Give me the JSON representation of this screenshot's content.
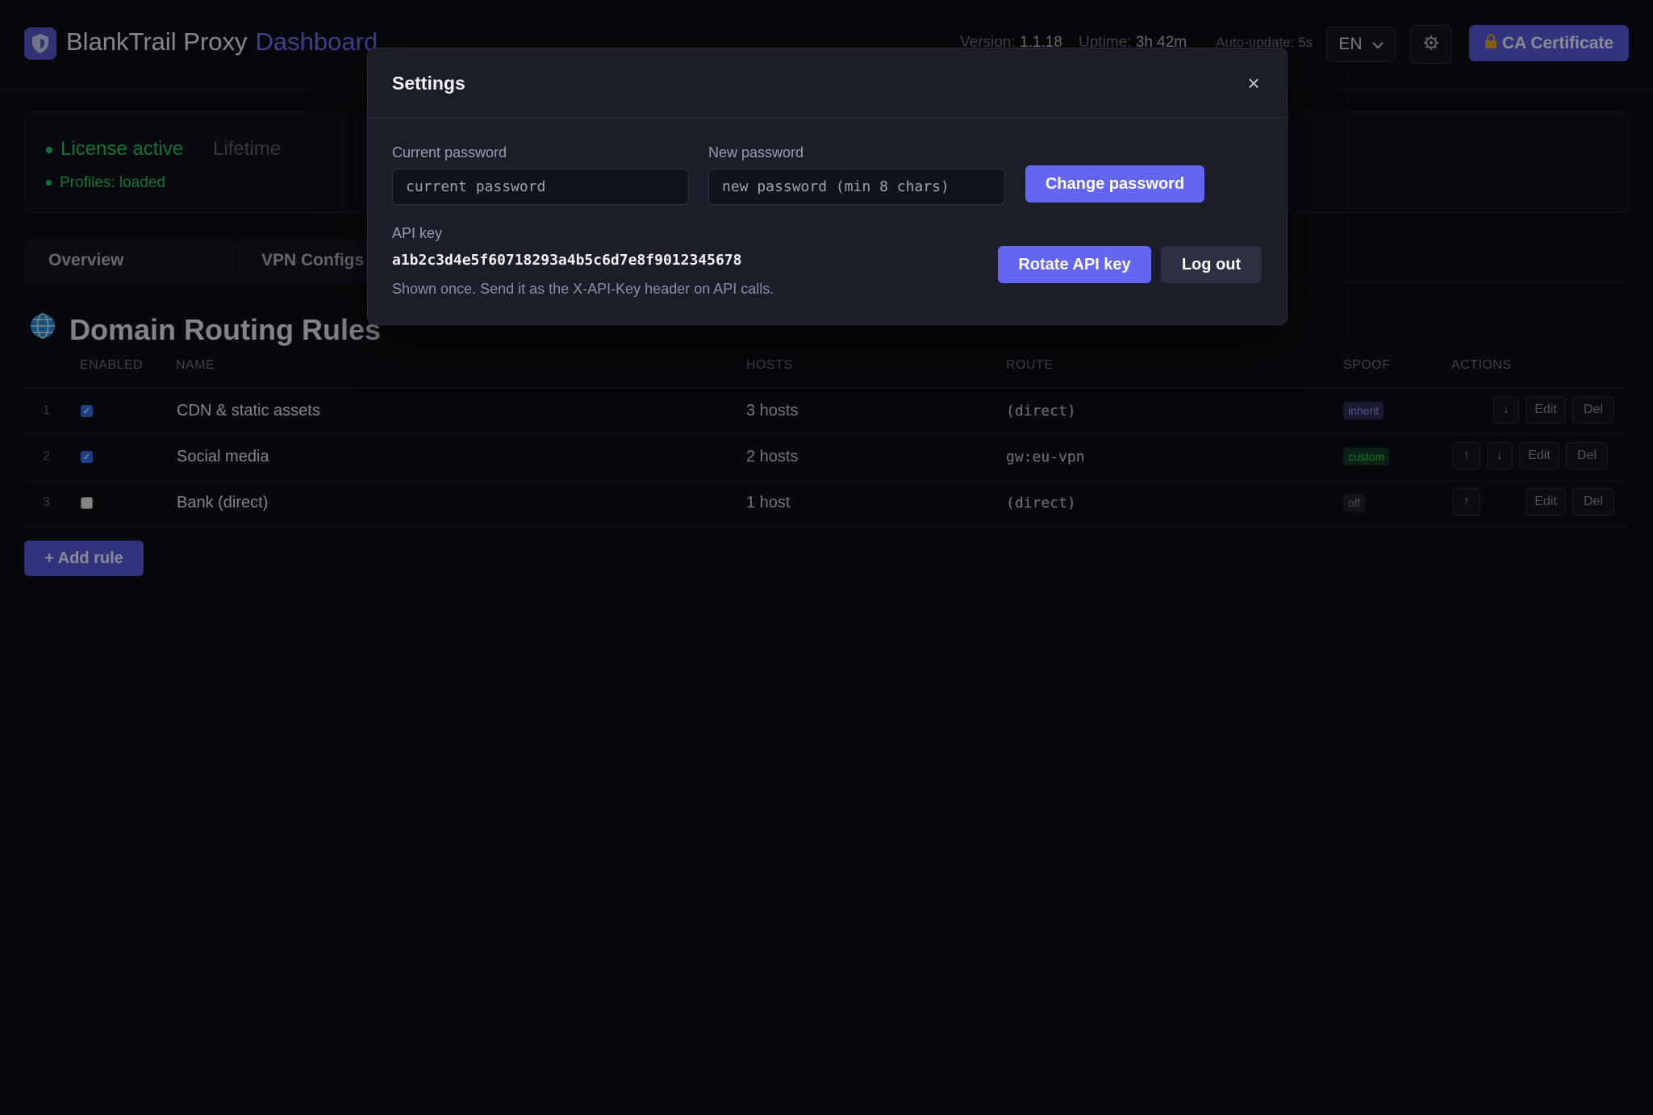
{
  "header": {
    "app_name": "BlankTrail Proxy",
    "app_section": "Dashboard",
    "version_label": "Version:",
    "version_value": "1.1.18",
    "uptime_label": "Uptime:",
    "uptime_value": "3h 42m",
    "auto_update": "Auto-update: 5s",
    "language": "EN",
    "ca_button": "CA Certificate",
    "icons": {
      "logo": "shield-icon",
      "settings": "gear-icon",
      "ca": "lock-icon",
      "language": "chevron-down-icon"
    }
  },
  "license": {
    "status": "License active",
    "plan": "Lifetime",
    "profiles": "Profiles: loaded"
  },
  "tabs": [
    {
      "label": "Overview"
    },
    {
      "label": "VPN Configs"
    }
  ],
  "rules": {
    "title": "Domain Routing Rules",
    "icon": "globe-icon",
    "columns": [
      "ENABLED",
      "NAME",
      "HOSTS",
      "ROUTE",
      "SPOOF",
      "ACTIONS"
    ],
    "rows": [
      {
        "index": "1",
        "enabled": true,
        "name": "CDN & static assets",
        "hosts": "3 hosts",
        "route": "(direct)",
        "spoof": "inherit"
      },
      {
        "index": "2",
        "enabled": true,
        "name": "Social media",
        "hosts": "2 hosts",
        "route": "gw:eu-vpn",
        "spoof": "custom"
      },
      {
        "index": "3",
        "enabled": false,
        "name": "Bank (direct)",
        "hosts": "1 host",
        "route": "(direct)",
        "spoof": "off"
      }
    ],
    "action_labels": {
      "up": "↑",
      "down": "↓",
      "edit": "Edit",
      "delete": "Del"
    },
    "add_button": "+ Add rule"
  },
  "settings_modal": {
    "title": "Settings",
    "close": "×",
    "current_password_label": "Current password",
    "current_password_placeholder": "current password",
    "new_password_label": "New password",
    "new_password_placeholder": "new password (min 8 chars)",
    "change_password_button": "Change password",
    "api_key_label": "API key",
    "api_key_value": "a1b2c3d4e5f60718293a4b5c6d7e8f9012345678",
    "api_key_hint": "Shown once. Send it as the X-API-Key header on API calls.",
    "rotate_button": "Rotate API key",
    "logout_button": "Log out"
  },
  "colors": {
    "accent": "#6366f1",
    "success": "#22c55e",
    "background": "#0d0e14",
    "modal": "#1b1d28"
  }
}
